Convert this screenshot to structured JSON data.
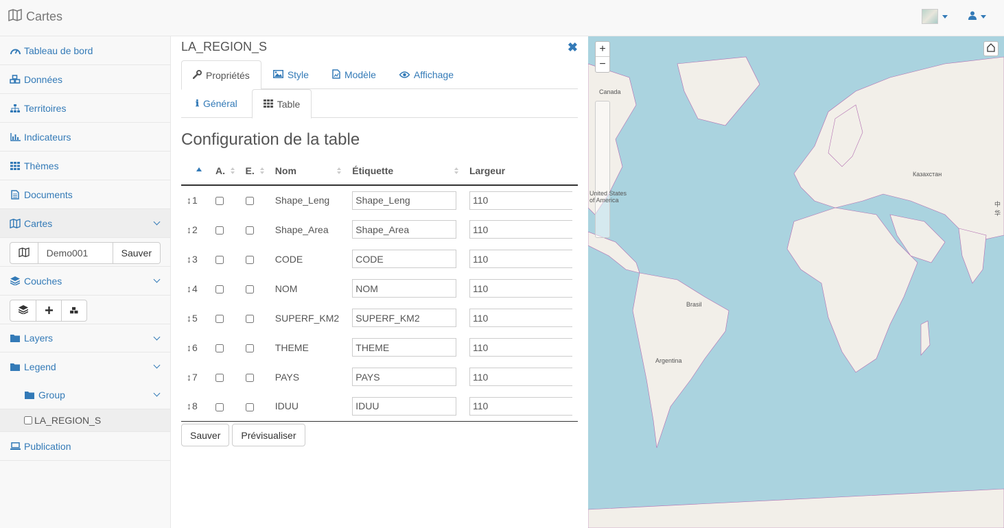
{
  "app": {
    "brand": "Cartes"
  },
  "sidebar": {
    "items": [
      {
        "label": "Tableau de bord",
        "icon": "dashboard-icon"
      },
      {
        "label": "Données",
        "icon": "cubes-icon"
      },
      {
        "label": "Territoires",
        "icon": "sitemap-icon"
      },
      {
        "label": "Indicateurs",
        "icon": "bar-chart-icon"
      },
      {
        "label": "Thèmes",
        "icon": "grid-icon"
      },
      {
        "label": "Documents",
        "icon": "file-icon"
      }
    ],
    "cartes": {
      "label": "Cartes",
      "map_name": "Demo001",
      "save_label": "Sauver"
    },
    "couches": {
      "label": "Couches"
    },
    "tree": {
      "layers": "Layers",
      "legend": "Legend",
      "group": "Group",
      "leaf": "LA_REGION_S"
    },
    "publication": "Publication"
  },
  "panel": {
    "title": "LA_REGION_S",
    "tabs": [
      {
        "label": "Propriétés",
        "active": true
      },
      {
        "label": "Style",
        "active": false
      },
      {
        "label": "Modèle",
        "active": false
      },
      {
        "label": "Affichage",
        "active": false
      }
    ],
    "subtabs": [
      {
        "label": "Général",
        "active": false
      },
      {
        "label": "Table",
        "active": true
      }
    ],
    "section_title": "Configuration de la table",
    "table": {
      "headers": [
        "A.",
        "E.",
        "Nom",
        "Étiquette",
        "Largeur"
      ],
      "rows": [
        {
          "order": "1",
          "nom": "Shape_Leng",
          "etiquette": "Shape_Leng",
          "largeur": "110"
        },
        {
          "order": "2",
          "nom": "Shape_Area",
          "etiquette": "Shape_Area",
          "largeur": "110"
        },
        {
          "order": "3",
          "nom": "CODE",
          "etiquette": "CODE",
          "largeur": "110"
        },
        {
          "order": "4",
          "nom": "NOM",
          "etiquette": "NOM",
          "largeur": "110"
        },
        {
          "order": "5",
          "nom": "SUPERF_KM2",
          "etiquette": "SUPERF_KM2",
          "largeur": "110"
        },
        {
          "order": "6",
          "nom": "THEME",
          "etiquette": "THEME",
          "largeur": "110"
        },
        {
          "order": "7",
          "nom": "PAYS",
          "etiquette": "PAYS",
          "largeur": "110"
        },
        {
          "order": "8",
          "nom": "IDUU",
          "etiquette": "IDUU",
          "largeur": "110"
        }
      ]
    },
    "actions": {
      "save": "Sauver",
      "preview": "Prévisualiser"
    }
  },
  "map": {
    "zoom_in": "+",
    "zoom_out": "−",
    "labels": {
      "canada": "Canada",
      "usa_line1": "United States",
      "usa_line2": "of America",
      "kazakhstan": "Казахстан",
      "brasil": "Brasil",
      "argentina": "Argentina",
      "china": "中华"
    },
    "colors": {
      "sea": "#aad3df",
      "land": "#f2efe9",
      "borders": "#b16bb0"
    }
  },
  "colors": {
    "link": "#337ab7"
  }
}
